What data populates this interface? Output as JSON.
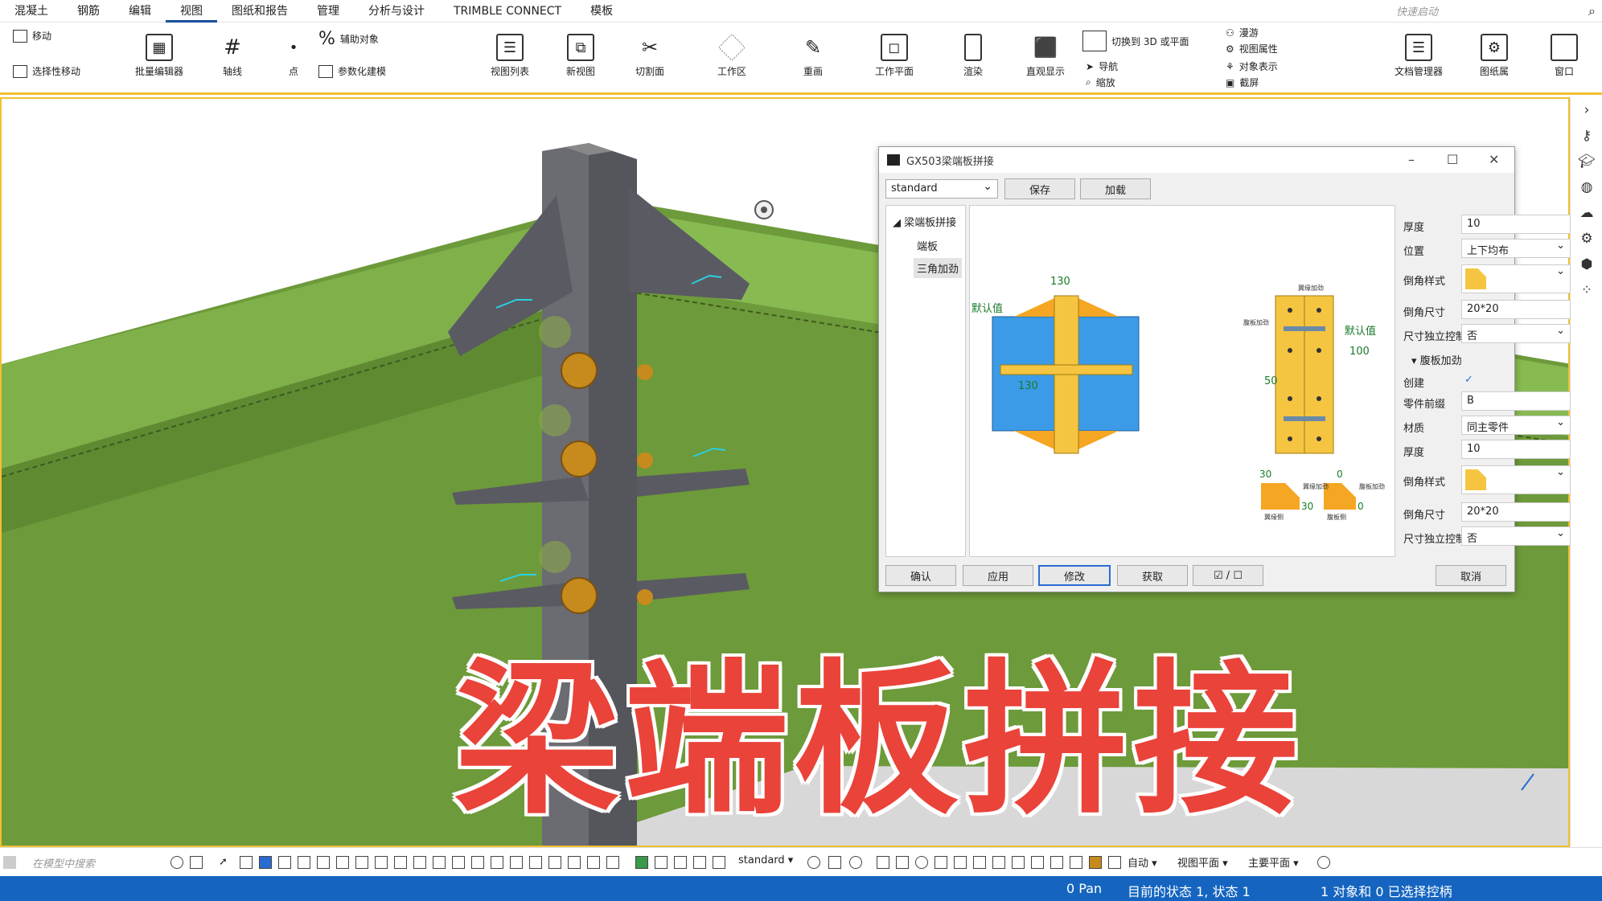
{
  "menu": {
    "tabs": [
      "混凝土",
      "钢筋",
      "编辑",
      "视图",
      "图纸和报告",
      "管理",
      "分析与设计",
      "TRIMBLE CONNECT",
      "模板"
    ],
    "active_tab": "视图",
    "quick_launch_placeholder": "快速启动"
  },
  "ribbon": {
    "move": "移动",
    "selective_move": "选择性移动",
    "batch_editor": "批量编辑器",
    "grid": "轴线",
    "point": "点",
    "helper_object": "辅助对象",
    "parametric": "参数化建模",
    "view_list": "视图列表",
    "new_view": "新视图",
    "cut_plane": "切割面",
    "work_area": "工作区",
    "redraw": "重画",
    "work_plane": "工作平面",
    "render": "渲染",
    "direct_display": "直观显示",
    "switch_3d": "切换到 3D 或平面",
    "navigate": "导航",
    "zoom": "缩放",
    "roam": "漫游",
    "view_properties": "视图属性",
    "object_representation": "对象表示",
    "screenshot": "截屏",
    "doc_manager": "文档管理器",
    "drawing_props": "图纸属",
    "window": "窗口"
  },
  "dialog": {
    "title": "GX503梁端板拼接",
    "preset": "standard",
    "save_label": "保存",
    "load_label": "加载",
    "tree": {
      "root": "梁端板拼接",
      "child1": "端板",
      "child2": "三角加劲"
    },
    "preview": {
      "dim_130_top": "130",
      "dim_130_mid": "130",
      "default_left": "默认值",
      "default_right": "默认值",
      "dim_100": "100",
      "dim_50": "50",
      "dim_30_a": "30",
      "dim_30_b": "30",
      "dim_0_a": "0",
      "dim_0_b": "0",
      "label_flange_stiff": "翼缘加劲",
      "label_web_stiff": "腹板加劲",
      "label_flange_stiff2": "翼缘加劲",
      "label_web_stiff2": "腹板加劲",
      "label_side1": "翼缘侧",
      "label_side2": "腹板侧"
    },
    "props": {
      "thickness_label": "厚度",
      "thickness_value": "10",
      "position_label": "位置",
      "position_value": "上下均布",
      "chamfer_style_label": "倒角样式",
      "chamfer_size_label": "倒角尺寸",
      "chamfer_size_value": "20*20",
      "indep_label": "尺寸独立控制",
      "indep_value": "否",
      "web_section": "腹板加劲",
      "create_label": "创建",
      "create_value": "✓",
      "prefix_label": "零件前缀",
      "prefix_value": "B",
      "material_label": "材质",
      "material_value": "同主零件",
      "thickness2_label": "厚度",
      "thickness2_value": "10",
      "chamfer_style2_label": "倒角样式",
      "chamfer_size2_label": "倒角尺寸",
      "chamfer_size2_value": "20*20",
      "indep2_label": "尺寸独立控制",
      "indep2_value": "否"
    },
    "buttons": {
      "ok": "确认",
      "apply": "应用",
      "modify": "修改",
      "get": "获取",
      "toggle": "☑ / ☐",
      "cancel": "取消"
    }
  },
  "overlay_title": "梁端板拼接",
  "bottom": {
    "search_placeholder": "在模型中搜索",
    "filter": "standard",
    "auto": "自动",
    "view_plane": "视图平面",
    "main_plane": "主要平面"
  },
  "status": {
    "pan": "0 Pan",
    "state": "目前的状态 1, 状态 1",
    "selection": "1 对象和 0 已选择控柄"
  },
  "colors": {
    "accent": "#1a4f9c",
    "status_bar": "#1565c0",
    "title_red": "#e9433a",
    "beam_green": "#6d9a3a",
    "steel_gray": "#6b6b72",
    "bolt_orange": "#c78a1c"
  }
}
